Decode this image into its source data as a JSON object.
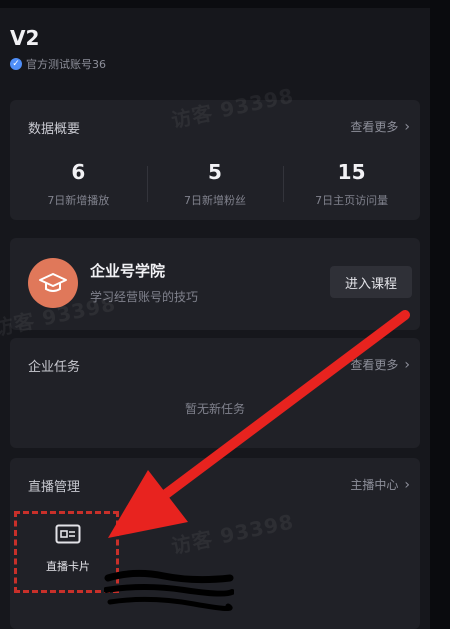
{
  "account": {
    "name": "V2",
    "verify_label": "官方测试账号36"
  },
  "data_overview": {
    "title": "数据概要",
    "more_label": "查看更多",
    "stats": [
      {
        "value": "6",
        "label": "7日新增播放"
      },
      {
        "value": "5",
        "label": "7日新增粉丝"
      },
      {
        "value": "15",
        "label": "7日主页访问量"
      }
    ]
  },
  "academy": {
    "title": "企业号学院",
    "subtitle": "学习经营账号的技巧",
    "button_label": "进入课程"
  },
  "tasks": {
    "title": "企业任务",
    "more_label": "查看更多",
    "empty_text": "暂无新任务"
  },
  "live": {
    "title": "直播管理",
    "more_label": "主播中心",
    "card_label": "直播卡片"
  },
  "watermark": "访客 93398",
  "colors": {
    "background": "#16171c",
    "card": "#202127",
    "academy_icon": "#e0785a",
    "verify": "#4f8ef7",
    "annotation": "#e8231f"
  }
}
